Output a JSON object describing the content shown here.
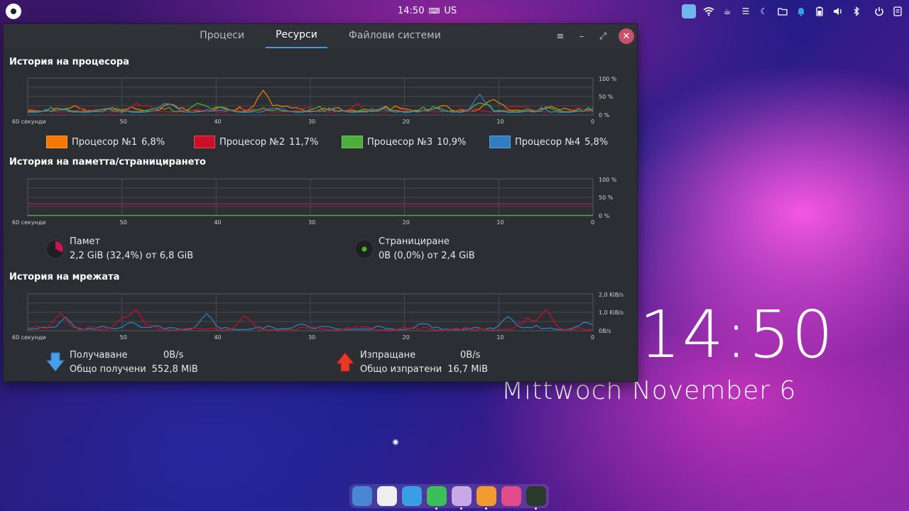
{
  "top_panel": {
    "time": "14:50",
    "keyboard_layout": "US"
  },
  "window": {
    "tabs": [
      {
        "label": "Процеси",
        "active": false
      },
      {
        "label": "Ресурси",
        "active": true
      },
      {
        "label": "Файлови системи",
        "active": false
      }
    ],
    "controls": {
      "menu": "≡",
      "minimize": "–",
      "maximize": "⤢",
      "close": "✕"
    }
  },
  "cpu": {
    "title": "История на процесора",
    "y_labels": [
      "100 %",
      "50 %",
      "0 %"
    ],
    "x_labels": [
      "60 секунди",
      "50",
      "40",
      "30",
      "20",
      "10",
      "0"
    ],
    "legend": [
      {
        "label": "Процесор №1",
        "value": "6,8%",
        "color": "#f57900"
      },
      {
        "label": "Процесор №2",
        "value": "11,7%",
        "color": "#cc0e2a"
      },
      {
        "label": "Процесор №3",
        "value": "10,9%",
        "color": "#4caf39"
      },
      {
        "label": "Процесор №4",
        "value": "5,8%",
        "color": "#2f7fc0"
      }
    ]
  },
  "memory": {
    "title": "История на паметта/страницирането",
    "y_labels": [
      "100 %",
      "50 %",
      "0 %"
    ],
    "x_labels": [
      "60 секунди",
      "50",
      "40",
      "30",
      "20",
      "10",
      "0"
    ],
    "mem_label": "Памет",
    "mem_value": "2,2 GiB (32,4%) от 6,8 GiB",
    "swap_label": "Странициране",
    "swap_value": "0B (0,0%) от 2,4 GiB",
    "mem_color": "#c2184f",
    "swap_color": "#4caf39",
    "mem_fraction": 0.324,
    "swap_fraction": 0.0
  },
  "network": {
    "title": "История на мрежата",
    "y_labels": [
      "2,0 KiB/s",
      "1,0 KiB/s",
      "0B/s"
    ],
    "x_labels": [
      "60 секунди",
      "50",
      "40",
      "30",
      "20",
      "10",
      "0"
    ],
    "recv_label": "Получаване",
    "recv_rate": "0B/s",
    "recv_total_label": "Общо получени",
    "recv_total": "552,8 MiB",
    "send_label": "Изпращане",
    "send_rate": "0B/s",
    "send_total_label": "Общо изпратени",
    "send_total": "16,7 MiB",
    "recv_color": "#2f7fc0",
    "send_color": "#cc0e2a"
  },
  "desktop": {
    "time": "14:50",
    "date": "Mittwoch November  6"
  },
  "dock": [
    {
      "name": "dock-browser",
      "color": "#4a86d6"
    },
    {
      "name": "dock-music",
      "color": "#eeeeee"
    },
    {
      "name": "dock-text-editor",
      "color": "#3a9ee6"
    },
    {
      "name": "dock-spreadsheet",
      "color": "#3cbf5a"
    },
    {
      "name": "dock-files",
      "color": "#c9a8e8"
    },
    {
      "name": "dock-firefox",
      "color": "#f29b30"
    },
    {
      "name": "dock-settings",
      "color": "#e24c8a"
    },
    {
      "name": "dock-system-monitor",
      "color": "#2a3a2a"
    }
  ]
}
